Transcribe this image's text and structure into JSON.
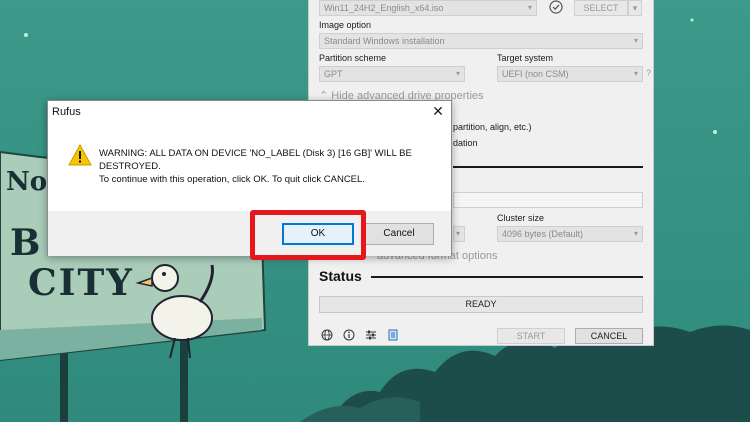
{
  "rufus": {
    "boot_selection_value": "Win11_24H2_English_x64.iso",
    "select_button": "SELECT",
    "image_option_label": "Image option",
    "image_option_value": "Standard Windows installation",
    "partition_scheme_label": "Partition scheme",
    "partition_scheme_value": "GPT",
    "target_system_label": "Target system",
    "target_system_value": "UEFI (non CSM)",
    "help_glyph": "?",
    "hide_advanced": "Hide advanced drive properties",
    "partial_option_1": "partition, align, etc.)",
    "partial_option_2": "dation",
    "cluster_size_label": "Cluster size",
    "cluster_size_value": "4096 bytes (Default)",
    "advanced_format": "advanced format options",
    "status_title": "Status",
    "status_value": "READY",
    "start_button": "START",
    "cancel_button": "CANCEL"
  },
  "dialog": {
    "title": "Rufus",
    "close_glyph": "✕",
    "message_line1": "WARNING: ALL DATA ON DEVICE 'NO_LABEL (Disk 3) [16 GB]' WILL BE",
    "message_line2": "DESTROYED.",
    "message_line3": "To continue with this operation, click OK. To quit click CANCEL.",
    "ok_button": "OK",
    "cancel_button": "Cancel"
  },
  "billboard": {
    "line1": "No",
    "line2": "B    H",
    "line3": "CITY"
  },
  "colors": {
    "highlight": "#e5171c",
    "focus": "#0078d7",
    "warning": "#f7c600"
  },
  "icons": {
    "warning": "warning-icon",
    "check": "check-icon",
    "globe": "globe-icon",
    "info": "info-icon",
    "settings": "settings-sliders-icon",
    "log": "log-icon"
  }
}
